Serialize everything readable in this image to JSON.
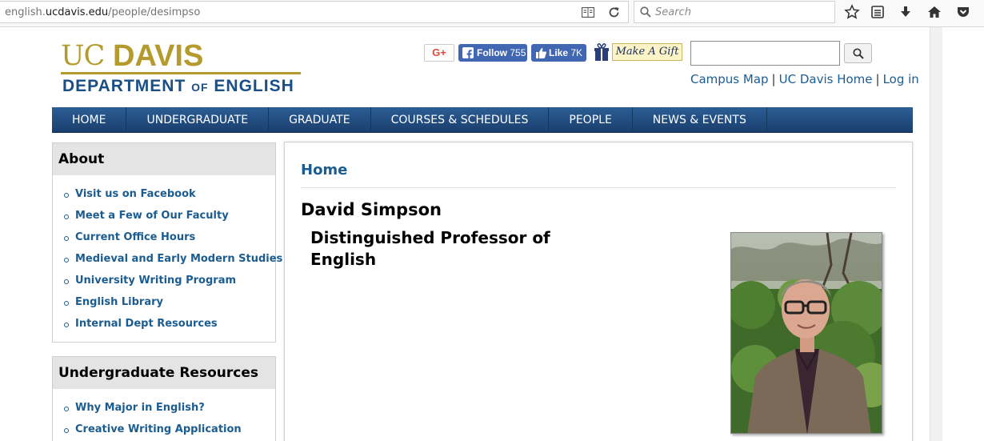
{
  "browser": {
    "url_prefix": "english.",
    "url_domain": "ucdavis.edu",
    "url_path": "/people/desimpso",
    "search_placeholder": "Search"
  },
  "header": {
    "logo_uc": "UC",
    "logo_davis": "DAVIS",
    "dept_part1": "DEPARTMENT",
    "dept_of": "OF",
    "dept_part2": "ENGLISH",
    "gplus_label": "G+",
    "fb_follow_label": "Follow",
    "fb_follow_count": "755",
    "fb_like_label": "Like",
    "fb_like_count": "7K",
    "gift_label": "Make A Gift",
    "search_value": "",
    "links": [
      "Campus Map",
      "UC Davis Home",
      "Log in"
    ]
  },
  "nav": [
    "HOME",
    "UNDERGRADUATE",
    "GRADUATE",
    "COURSES & SCHEDULES",
    "PEOPLE",
    "NEWS & EVENTS"
  ],
  "sidebar": {
    "about": {
      "title": "About",
      "items": [
        "Visit us on Facebook",
        "Meet a Few of Our Faculty",
        "Current Office Hours",
        "Medieval and Early Modern Studies",
        "University Writing Program",
        "English Library",
        "Internal Dept Resources"
      ]
    },
    "undergrad": {
      "title": "Undergraduate Resources",
      "items": [
        "Why Major in English?",
        "Creative Writing Application"
      ]
    }
  },
  "main": {
    "breadcrumb": "Home",
    "name": "David Simpson",
    "title": "Distinguished Professor of English"
  },
  "colors": {
    "gold": "#b59a2d",
    "navy": "#1a4e86",
    "link": "#1b5c91",
    "nav_bg": "#1f4a7d"
  }
}
